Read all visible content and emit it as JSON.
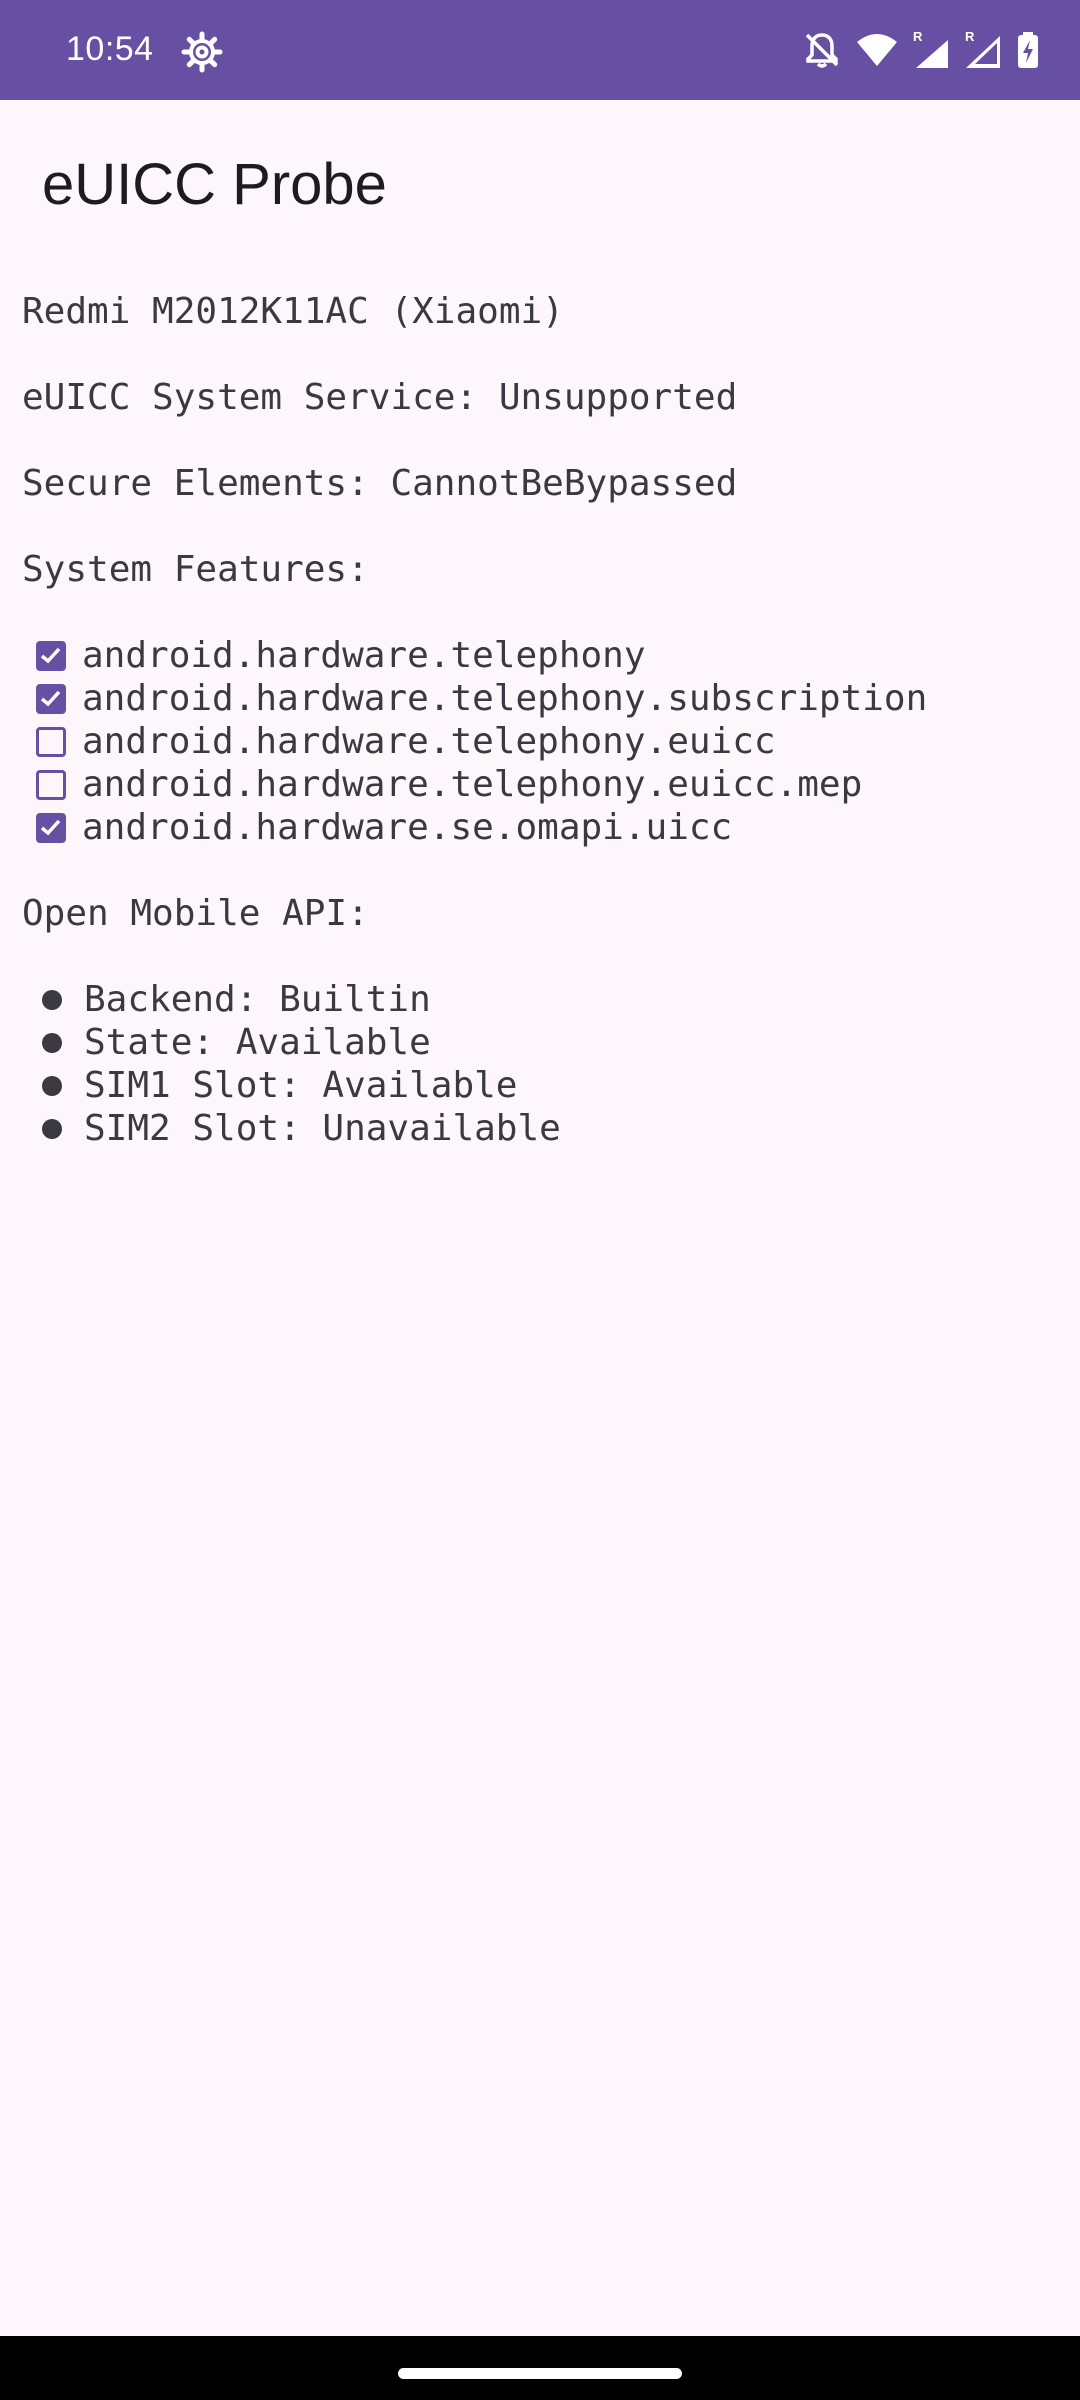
{
  "status_bar": {
    "time": "10:54",
    "background_color": "#6750a4",
    "icons": [
      "settings-gear-icon",
      "notifications-off-icon",
      "wifi-icon",
      "signal-roaming-1-icon",
      "signal-roaming-2-icon",
      "battery-charging-icon"
    ],
    "roaming_label": "R"
  },
  "app": {
    "title": "eUICC Probe"
  },
  "device": {
    "model": "Redmi M2012K11AC (Xiaomi)"
  },
  "euicc_service": "eUICC System Service: Unsupported",
  "secure_elements": "Secure Elements: CannotBeBypassed",
  "system_features": {
    "heading": "System Features:",
    "items": [
      {
        "label": "android.hardware.telephony",
        "checked": true
      },
      {
        "label": "android.hardware.telephony.subscription",
        "checked": true
      },
      {
        "label": "android.hardware.telephony.euicc",
        "checked": false
      },
      {
        "label": "android.hardware.telephony.euicc.mep",
        "checked": false
      },
      {
        "label": "android.hardware.se.omapi.uicc",
        "checked": true
      }
    ]
  },
  "open_mobile_api": {
    "heading": "Open Mobile API:",
    "items": [
      {
        "label": "Backend: Builtin"
      },
      {
        "label": "State: Available"
      },
      {
        "label": "SIM1 Slot: Available"
      },
      {
        "label": "SIM2 Slot: Unavailable"
      }
    ]
  },
  "colors": {
    "accent": "#6750a4",
    "background": "#fdf7fc",
    "text": "#3a3840"
  }
}
